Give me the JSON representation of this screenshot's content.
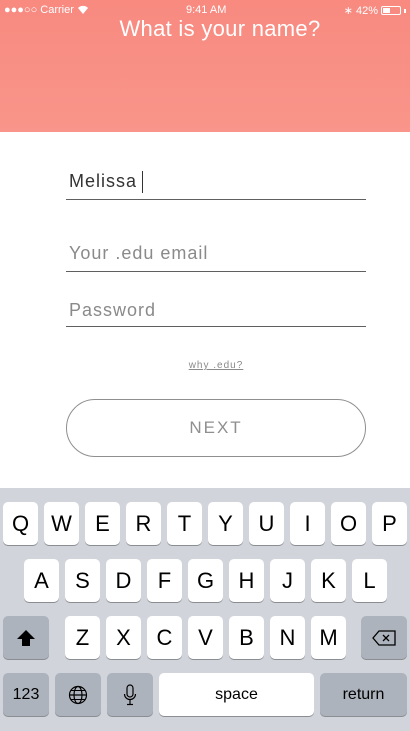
{
  "status_bar": {
    "carrier": "●●●○○ Carrier",
    "time": "9:41 AM",
    "battery": "42%"
  },
  "header": {
    "title": "What is your name?",
    "color": "#f88a80"
  },
  "form": {
    "name_value": "Melissa",
    "email_placeholder": "Your .edu email",
    "password_placeholder": "Password",
    "why_link": "why .edu?",
    "next_label": "NEXT"
  },
  "keyboard": {
    "row1": [
      "Q",
      "W",
      "E",
      "R",
      "T",
      "Y",
      "U",
      "I",
      "O",
      "P"
    ],
    "row2": [
      "A",
      "S",
      "D",
      "F",
      "G",
      "H",
      "J",
      "K",
      "L"
    ],
    "row3": [
      "Z",
      "X",
      "C",
      "V",
      "B",
      "N",
      "M"
    ],
    "numbers_label": "123",
    "space_label": "space",
    "return_label": "return",
    "icons": [
      "shift-icon",
      "backspace-icon",
      "globe-icon",
      "microphone-icon"
    ]
  }
}
